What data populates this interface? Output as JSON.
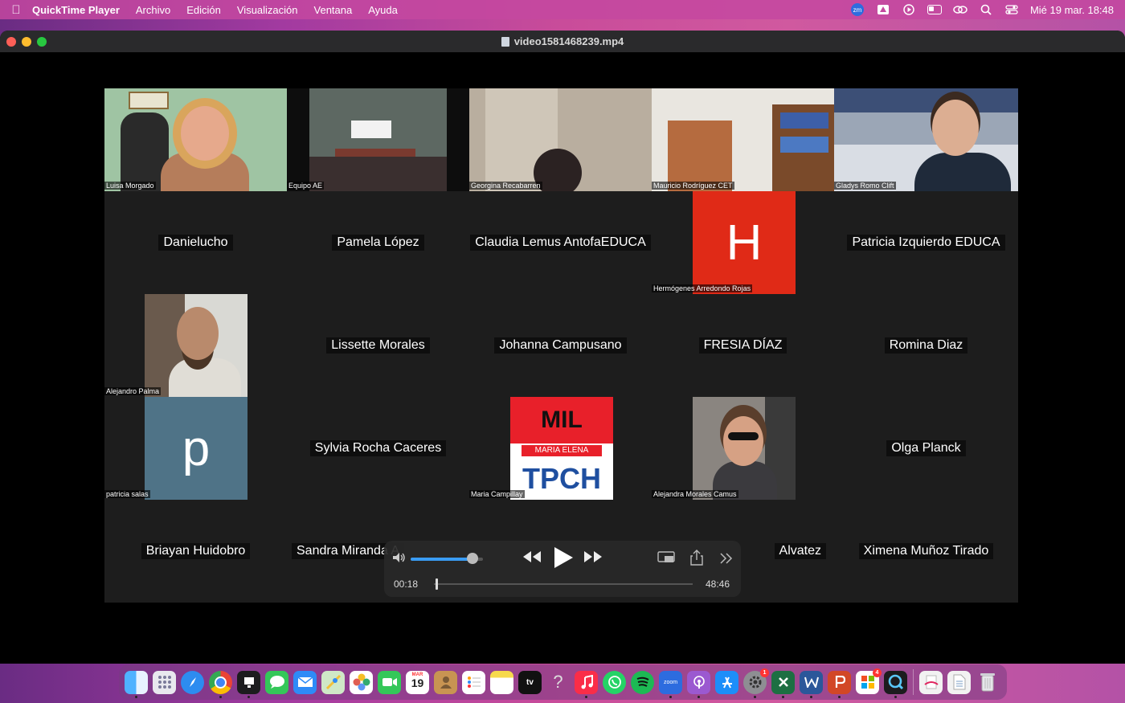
{
  "menubar": {
    "app_name": "QuickTime Player",
    "items": [
      "Archivo",
      "Edición",
      "Visualización",
      "Ventana",
      "Ayuda"
    ],
    "zoom_badge": "zm",
    "clock": "Mié 19 mar.  18:48"
  },
  "window": {
    "title": "video1581468239.mp4"
  },
  "gallery": {
    "video_tiles": [
      {
        "name": "Luisa Morgado"
      },
      {
        "name": "Equipo AE"
      },
      {
        "name": "Georgina Recabarren"
      },
      {
        "name": "Mauricio Rodríguez CET"
      },
      {
        "name": "Gladys Romo Clift"
      },
      {
        "name": "Hermógenes Arredondo Rojas",
        "avatar_letter": "H"
      },
      {
        "name": "Alejandro Palma"
      },
      {
        "name": "patricia salas",
        "avatar_letter": "p"
      },
      {
        "name": "Maria Campillay",
        "logo_top": "MIL",
        "logo_middle": "MARIA ELENA",
        "logo_bottom": "TPCH"
      },
      {
        "name": "Alejandra Morales Camus"
      }
    ],
    "name_tiles": [
      "Danielucho",
      "Pamela López",
      "Claudia Lemus AntofaEDUCA",
      "Patricia Izquierdo EDUCA",
      "Lissette Morales",
      "Johanna Campusano",
      "FRESIA DÍAZ",
      "Romina Diaz",
      "Sylvia Rocha Caceres",
      "Olga Planck",
      "Briayan Huidobro",
      "Sandra Miranda A",
      "Alvatez",
      "Ximena Muñoz Tirado"
    ]
  },
  "player": {
    "current_time": "00:18",
    "duration": "48:46",
    "volume_fraction": 0.85,
    "progress_fraction": 0.006
  },
  "dock": {
    "calendar_month": "MAR",
    "calendar_day": "19",
    "zoom_label": "zoom",
    "tv_label": "tv",
    "settings_badge": "1",
    "photos_badge": "4"
  }
}
